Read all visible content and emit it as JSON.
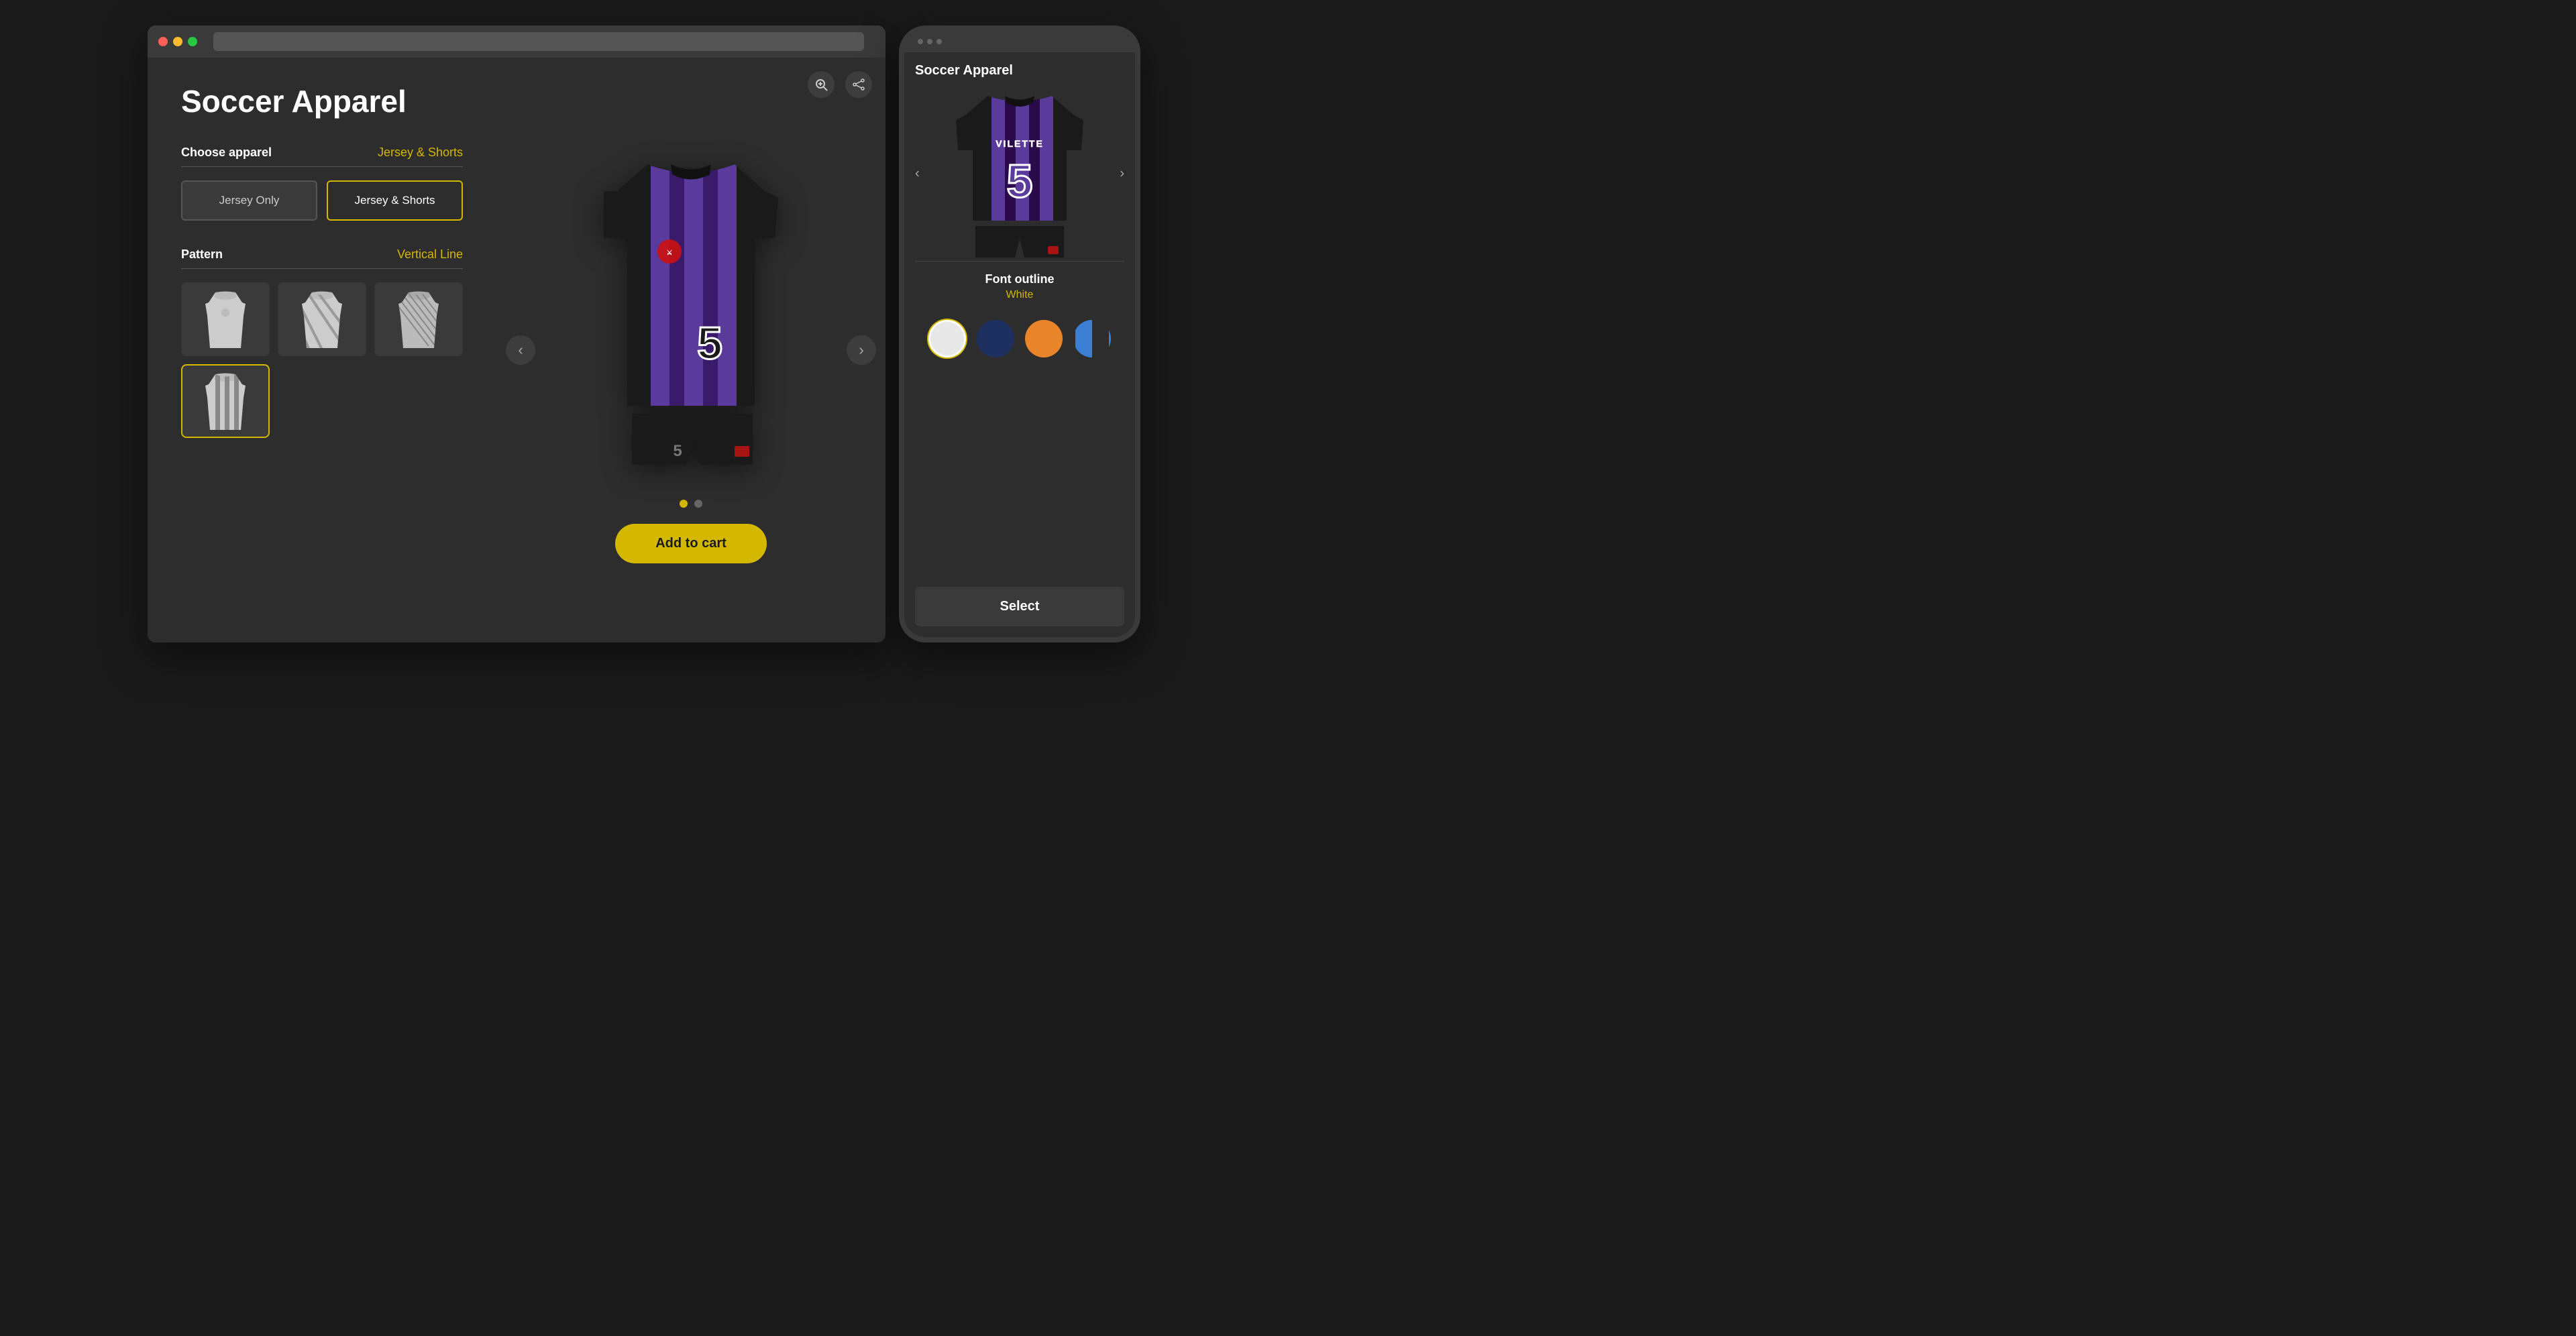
{
  "browser": {
    "dots": [
      "red",
      "yellow",
      "green"
    ],
    "title": "Soccer Apparel"
  },
  "desktop": {
    "page_title": "Soccer Apparel",
    "apparel_section": {
      "label": "Choose apparel",
      "selected_value": "Jersey & Shorts"
    },
    "apparel_buttons": [
      {
        "id": "jersey-only",
        "label": "Jersey Only",
        "active": false
      },
      {
        "id": "jersey-shorts",
        "label": "Jersey & Shorts",
        "active": true
      }
    ],
    "pattern_section": {
      "label": "Pattern",
      "selected_value": "Vertical Line"
    },
    "patterns": [
      {
        "id": "plain",
        "active": false
      },
      {
        "id": "diagonal-stripes",
        "active": false
      },
      {
        "id": "diagonal-lines",
        "active": false
      },
      {
        "id": "vertical-stripes",
        "active": true
      }
    ],
    "add_to_cart_label": "Add to cart",
    "dots": [
      {
        "active": true
      },
      {
        "active": false
      }
    ],
    "icons": {
      "zoom": "⊕",
      "share": "⎋"
    }
  },
  "mobile": {
    "title": "Soccer Apparel",
    "font_outline_label": "Font outline",
    "font_outline_value": "White",
    "select_label": "Select",
    "colors": [
      {
        "name": "white",
        "hex": "#e8e8e8",
        "selected": true
      },
      {
        "name": "navy",
        "hex": "#1e3060",
        "selected": false
      },
      {
        "name": "orange",
        "hex": "#e8842a",
        "selected": false
      },
      {
        "name": "blue",
        "hex": "#3b7fd4",
        "selected": false
      }
    ]
  }
}
